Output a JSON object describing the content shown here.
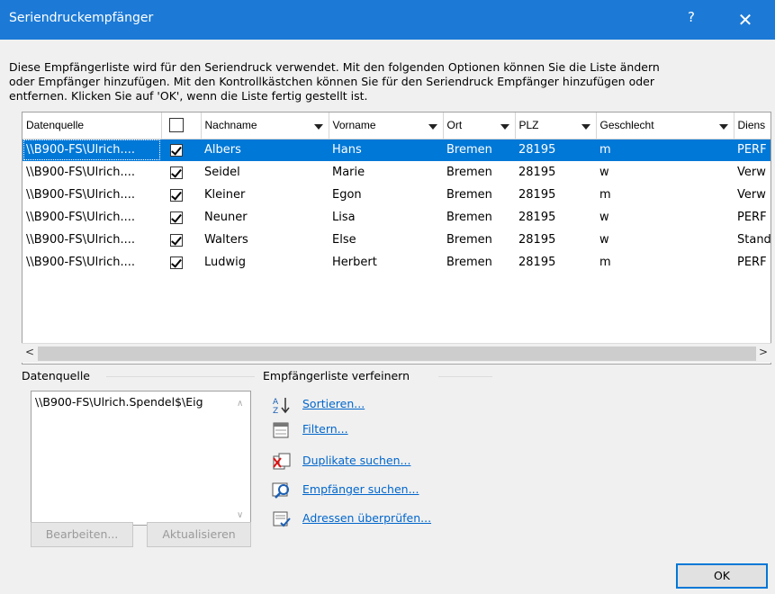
{
  "titlebar": {
    "title": "Seriendruckempfänger",
    "help": "?",
    "close": "✕"
  },
  "description": "Diese Empfängerliste wird für den Seriendruck verwendet. Mit den folgenden Optionen können Sie die Liste ändern\noder Empfänger hinzufügen. Mit den Kontrollkästchen können Sie für den Seriendruck Empfänger hinzufügen oder\nentfernen. Klicken Sie auf 'OK', wenn die Liste fertig gestellt ist.",
  "table": {
    "columns": [
      "Datenquelle",
      "",
      "Nachname",
      "Vorname",
      "Ort",
      "PLZ",
      "Geschlecht",
      "Diens"
    ],
    "rows": [
      [
        "\\\\B900-FS\\Ulrich....",
        "checked",
        "Albers",
        "Hans",
        "Bremen",
        "28195",
        "m",
        "PERF"
      ],
      [
        "\\\\B900-FS\\Ulrich....",
        "checked",
        "Seidel",
        "Marie",
        "Bremen",
        "28195",
        "w",
        "Verw"
      ],
      [
        "\\\\B900-FS\\Ulrich....",
        "checked",
        "Kleiner",
        "Egon",
        "Bremen",
        "28195",
        "m",
        "Verw"
      ],
      [
        "\\\\B900-FS\\Ulrich....",
        "checked",
        "Neuner",
        "Lisa",
        "Bremen",
        "28195",
        "w",
        "PERF"
      ],
      [
        "\\\\B900-FS\\Ulrich....",
        "checked",
        "Walters",
        "Else",
        "Bremen",
        "28195",
        "w",
        "Stand"
      ],
      [
        "\\\\B900-FS\\Ulrich....",
        "checked",
        "Ludwig",
        "Herbert",
        "Bremen",
        "28195",
        "m",
        "PERF"
      ]
    ],
    "selected_row": 0
  },
  "scrollbar": {
    "left": "<",
    "right": ">"
  },
  "datasource": {
    "label": "Datenquelle",
    "item": "\\\\B900-FS\\Ulrich.Spendel$\\Eig",
    "edit_button": "Bearbeiten...",
    "refresh_button": "Aktualisieren"
  },
  "refine": {
    "label": "Empfängerliste verfeinern",
    "links": [
      {
        "label": "Sortieren...",
        "icon": "sort-az-icon"
      },
      {
        "label": "Filtern...",
        "icon": "filter-icon"
      },
      {
        "label": "Duplikate suchen...",
        "icon": "duplicates-icon"
      },
      {
        "label": "Empfänger suchen...",
        "icon": "find-recipient-icon"
      },
      {
        "label": "Adressen überprüfen...",
        "icon": "validate-addresses-icon"
      }
    ]
  },
  "ok_button": "OK",
  "colors": {
    "titlebar": "#1c7ad6",
    "selection": "#0078d7",
    "link": "#0066cc"
  }
}
